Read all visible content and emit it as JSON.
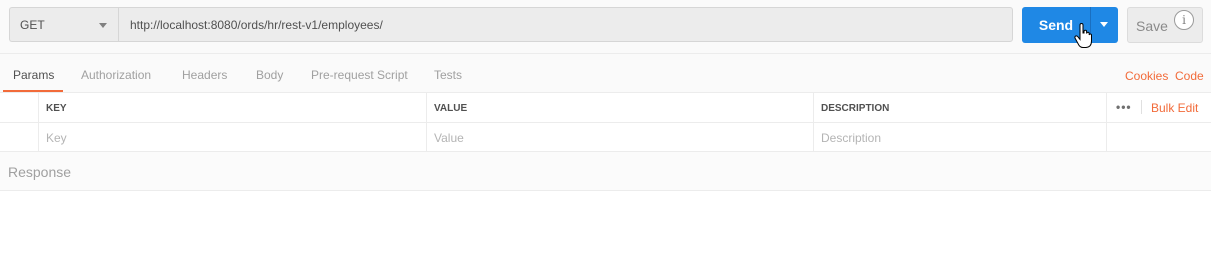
{
  "request": {
    "method": "GET",
    "url": "http://localhost:8080/ords/hr/rest-v1/employees/",
    "send_label": "Send",
    "save_label": "Save",
    "info_glyph": "i"
  },
  "tabs": [
    {
      "label": "Params",
      "active": true
    },
    {
      "label": "Authorization"
    },
    {
      "label": "Headers"
    },
    {
      "label": "Body"
    },
    {
      "label": "Pre-request Script"
    },
    {
      "label": "Tests"
    }
  ],
  "tab_links": {
    "cookies": "Cookies",
    "code": "Code"
  },
  "params_table": {
    "headers": {
      "key": "KEY",
      "value": "VALUE",
      "description": "DESCRIPTION"
    },
    "placeholders": {
      "key": "Key",
      "value": "Value",
      "description": "Description"
    },
    "more_glyph": "•••",
    "bulk_edit": "Bulk Edit"
  },
  "response": {
    "label": "Response"
  },
  "colors": {
    "accent": "#f26b3a",
    "send": "#1f88e5"
  }
}
